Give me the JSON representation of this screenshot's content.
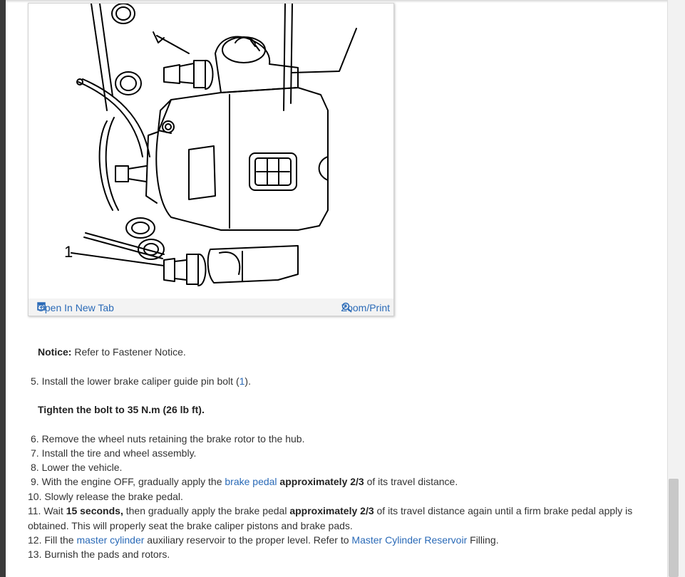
{
  "figure": {
    "callout_label": "1",
    "open_tab_label": "Open In New Tab",
    "zoom_label": "Zoom/Print"
  },
  "notice": {
    "label": "Notice:",
    "text": " Refer to Fastener Notice."
  },
  "steps": {
    "s5": {
      "prefix": "5. Install the lower brake caliper guide pin bolt (",
      "link": "1",
      "suffix": ")."
    },
    "tighten": "Tighten the bolt to 35 N.m (26 lb ft).",
    "s6": "6. Remove the wheel nuts retaining the brake rotor to the hub.",
    "s7": "7. Install the tire and wheel assembly.",
    "s8": "8. Lower the vehicle.",
    "s9": {
      "a": "9. With the engine OFF, gradually apply the ",
      "link": "brake pedal",
      "b": " approximately 2/3",
      "c": " of its travel distance."
    },
    "s10": "10. Slowly release the brake pedal.",
    "s11": {
      "a": "11. Wait ",
      "b": "15 seconds,",
      "c": " then gradually apply the brake pedal ",
      "d": "approximately 2/3",
      "e": " of its travel distance again until a firm brake pedal apply is",
      "line2": "obtained. This will properly seat the brake caliper pistons and brake pads."
    },
    "s12": {
      "a": "12. Fill the ",
      "link1": "master cylinder",
      "b": " auxiliary reservoir to the proper level. Refer to ",
      "link2": "Master Cylinder Reservoir",
      "c": " Filling."
    },
    "s13": "13. Burnish the pads and rotors."
  },
  "colors": {
    "link": "#2a6ab7",
    "text": "#333333"
  }
}
